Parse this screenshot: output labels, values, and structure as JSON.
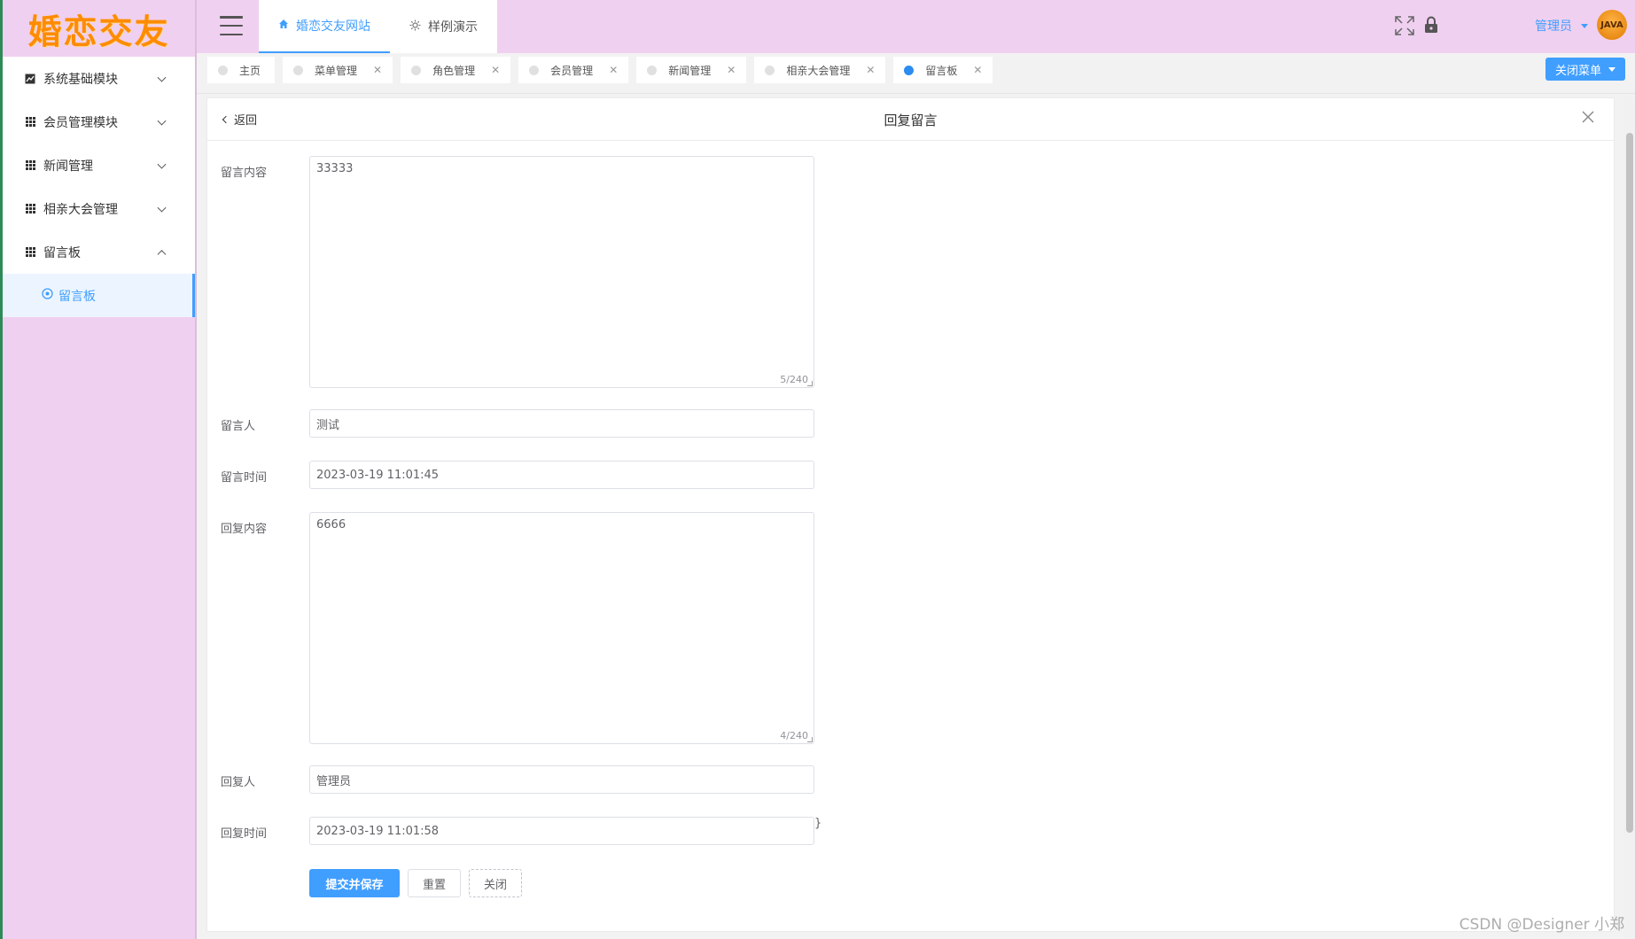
{
  "sidebar": {
    "logo_text": "婚恋交友",
    "items": [
      {
        "label": "系统基础模块",
        "icon": "chart-icon"
      },
      {
        "label": "会员管理模块",
        "icon": "grid-icon"
      },
      {
        "label": "新闻管理",
        "icon": "grid-icon"
      },
      {
        "label": "相亲大会管理",
        "icon": "grid-icon"
      },
      {
        "label": "留言板",
        "icon": "grid-icon"
      }
    ],
    "sub_item": {
      "label": "留言板",
      "icon": "gear-icon"
    }
  },
  "topbar": {
    "tabs": [
      {
        "label": "婚恋交友网站",
        "icon": "home-icon"
      },
      {
        "label": "样例演示",
        "icon": "sun-icon"
      }
    ],
    "admin_label": "管理员",
    "avatar_text": "JAVA"
  },
  "page_tabs": [
    {
      "label": "主页"
    },
    {
      "label": "菜单管理"
    },
    {
      "label": "角色管理"
    },
    {
      "label": "会员管理"
    },
    {
      "label": "新闻管理"
    },
    {
      "label": "相亲大会管理"
    },
    {
      "label": "留言板"
    }
  ],
  "close_menu_label": "关闭菜单",
  "card": {
    "back_label": "返回",
    "title": "回复留言"
  },
  "form": {
    "message_content": {
      "label": "留言内容",
      "value": "33333",
      "count": "5/240"
    },
    "author": {
      "label": "留言人",
      "value": "测试"
    },
    "message_time": {
      "label": "留言时间",
      "value": "2023-03-19 11:01:45"
    },
    "reply_content": {
      "label": "回复内容",
      "value": "6666",
      "count": "4/240"
    },
    "replier": {
      "label": "回复人",
      "value": "管理员"
    },
    "reply_time": {
      "label": "回复时间",
      "value": "2023-03-19 11:01:58"
    },
    "submit_label": "提交并保存",
    "reset_label": "重置",
    "close_label": "关闭"
  },
  "watermark": "CSDN @Designer 小郑",
  "colors": {
    "accent": "#409eff",
    "sidebar_bg": "#f0d0f0",
    "logo": "#ff8c00"
  }
}
